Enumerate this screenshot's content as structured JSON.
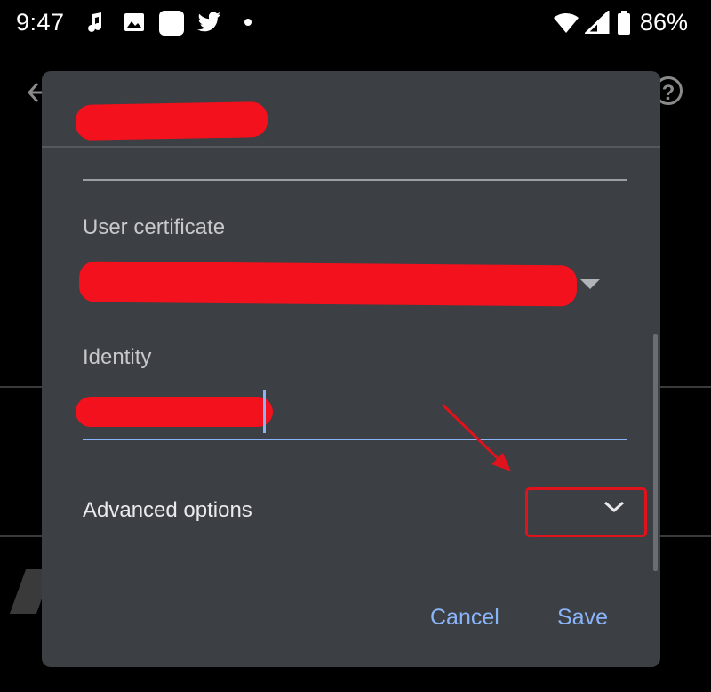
{
  "status_bar": {
    "time": "9:47",
    "battery": "86%",
    "icons": [
      "music-note-icon",
      "image-icon",
      "app-square-icon",
      "twitter-icon",
      "dot-icon",
      "wifi-icon",
      "signal-icon",
      "battery-icon"
    ]
  },
  "dialog": {
    "fields": {
      "user_certificate_label": "User certificate",
      "identity_label": "Identity"
    },
    "advanced_options_label": "Advanced options",
    "buttons": {
      "cancel": "Cancel",
      "save": "Save"
    }
  },
  "background": {
    "help_glyph": "?"
  },
  "colors": {
    "dialog_bg": "#3c3f43",
    "accent": "#8ab4f8",
    "redaction": "#f2111c",
    "annotation": "#e0121c"
  }
}
